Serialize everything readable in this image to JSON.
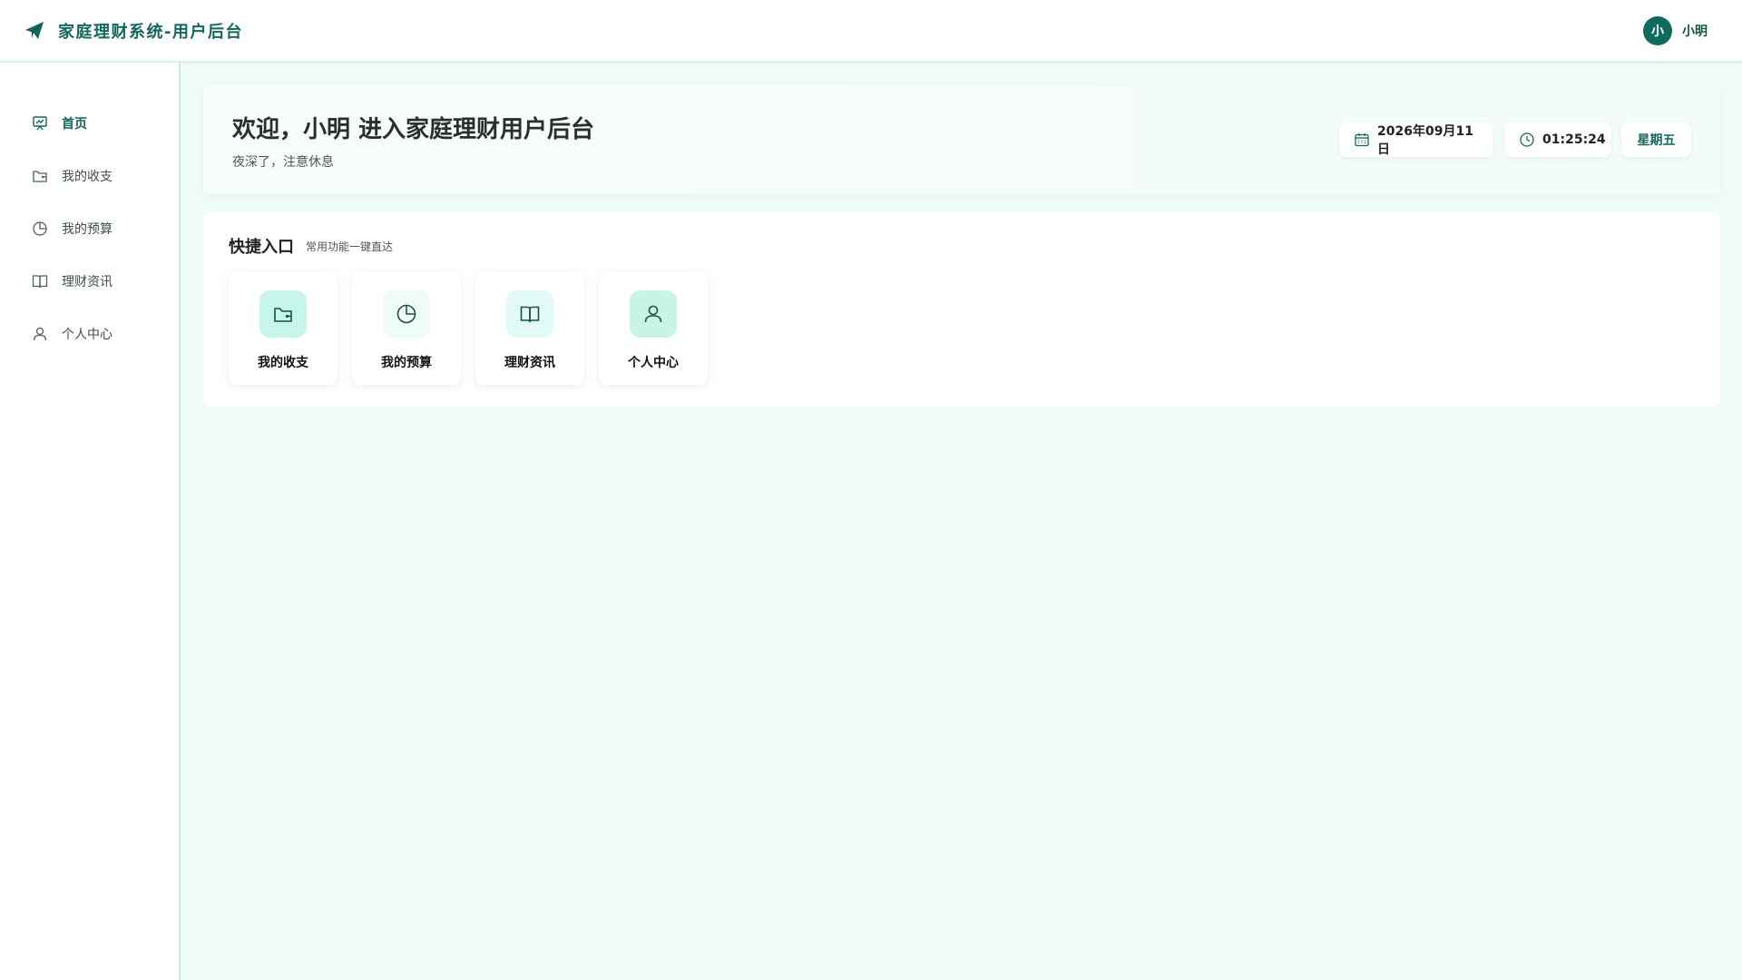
{
  "header": {
    "title": "家庭理财系统-用户后台",
    "user_avatar_text": "小",
    "user_name": "小明"
  },
  "sidebar": {
    "items": [
      {
        "label": "首页",
        "icon": "presentation-icon",
        "active": true
      },
      {
        "label": "我的收支",
        "icon": "wallet-icon",
        "active": false
      },
      {
        "label": "我的预算",
        "icon": "pie-chart-icon",
        "active": false
      },
      {
        "label": "理财资讯",
        "icon": "book-icon",
        "active": false
      },
      {
        "label": "个人中心",
        "icon": "user-icon",
        "active": false
      }
    ]
  },
  "welcome": {
    "title": "欢迎，小明 进入家庭理财用户后台",
    "subtitle": "夜深了，注意休息",
    "date": "2026年09月11日",
    "time": "01:25:24",
    "weekday": "星期五"
  },
  "quick": {
    "title": "快捷入口",
    "subtitle": "常用功能一键直达",
    "tiles": [
      {
        "label": "我的收支",
        "icon": "wallet-icon",
        "bg": "#c8f5ea"
      },
      {
        "label": "我的预算",
        "icon": "pie-chart-icon",
        "bg": "#eefbf7"
      },
      {
        "label": "理财资讯",
        "icon": "book-icon",
        "bg": "#e3fbf6"
      },
      {
        "label": "个人中心",
        "icon": "user-icon",
        "bg": "#c9f3e4"
      }
    ]
  },
  "colors": {
    "brand": "#14675c",
    "background": "#effbf8",
    "avatar": "#0f6b5e"
  }
}
